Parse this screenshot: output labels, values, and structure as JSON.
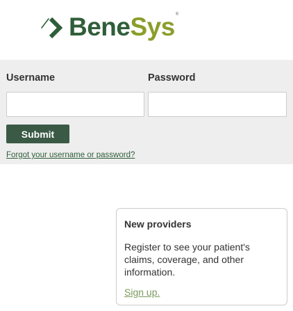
{
  "brand": {
    "part1": "Bene",
    "part2": "Sys",
    "trademark": "®",
    "colors": {
      "primary": "#2f5e3a",
      "secondary": "#8a9e2a"
    }
  },
  "login": {
    "username_label": "Username",
    "password_label": "Password",
    "username_value": "",
    "password_value": "",
    "submit_label": "Submit",
    "forgot_link": "Forgot your username or password?"
  },
  "providers": {
    "title": "New providers",
    "body": "Register to see your patient's claims, coverage, and other information.",
    "signup_link": "Sign up."
  }
}
